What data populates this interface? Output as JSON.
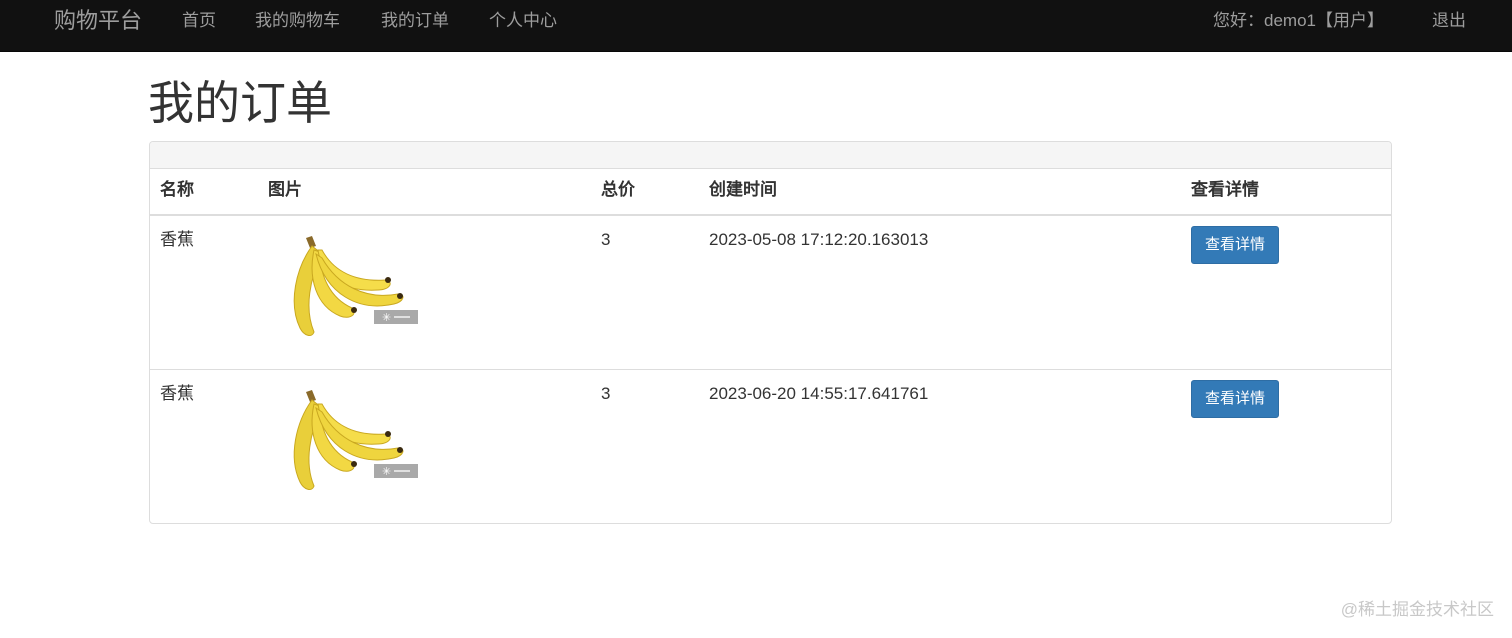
{
  "navbar": {
    "brand": "购物平台",
    "items": [
      "首页",
      "我的购物车",
      "我的订单",
      "个人中心"
    ],
    "greeting": "您好：demo1【用户】",
    "logout": "退出"
  },
  "page": {
    "title": "我的订单"
  },
  "table": {
    "headers": [
      "名称",
      "图片",
      "总价",
      "创建时间",
      "查看详情"
    ],
    "rows": [
      {
        "name": "香蕉",
        "total": "3",
        "created": "2023-05-08 17:12:20.163013",
        "button": "查看详情"
      },
      {
        "name": "香蕉",
        "total": "3",
        "created": "2023-06-20 14:55:17.641761",
        "button": "查看详情"
      }
    ]
  },
  "watermark": "@稀土掘金技术社区",
  "colors": {
    "navbar": "#111111",
    "button": "#337ab7",
    "panel_heading": "#f5f5f5"
  }
}
